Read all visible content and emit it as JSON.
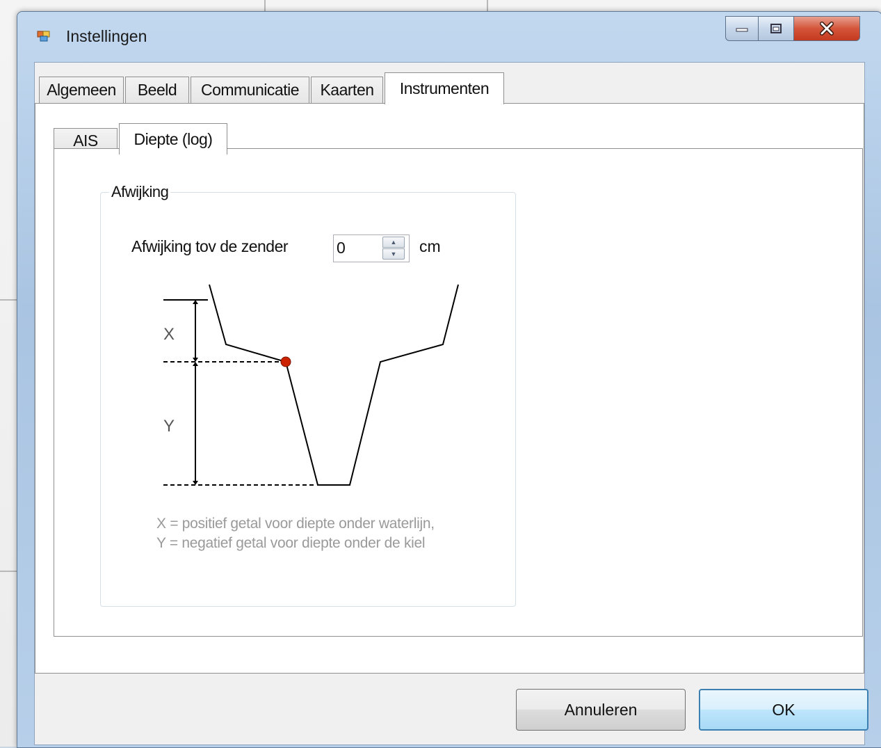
{
  "window": {
    "title": "Instellingen"
  },
  "tabs": [
    {
      "label": "Algemeen"
    },
    {
      "label": "Beeld"
    },
    {
      "label": "Communicatie"
    },
    {
      "label": "Kaarten"
    },
    {
      "label": "Instrumenten"
    }
  ],
  "active_tab": "Instrumenten",
  "subtabs": [
    {
      "label": "AIS"
    },
    {
      "label": "Diepte (log)"
    }
  ],
  "active_subtab": "Diepte (log)",
  "group": {
    "title": "Afwijking",
    "field_label": "Afwijking tov de zender",
    "field_value": "0",
    "unit": "cm"
  },
  "diagram": {
    "label_x": "X",
    "label_y": "Y",
    "legend_line1": "X = positief getal voor diepte onder waterlijn,",
    "legend_line2": "Y = negatief getal voor diepte onder de kiel"
  },
  "buttons": {
    "cancel": "Annuleren",
    "ok": "OK"
  },
  "colors": {
    "transducer_dot": "#cc2200",
    "ok_border": "#3c7fb1"
  }
}
